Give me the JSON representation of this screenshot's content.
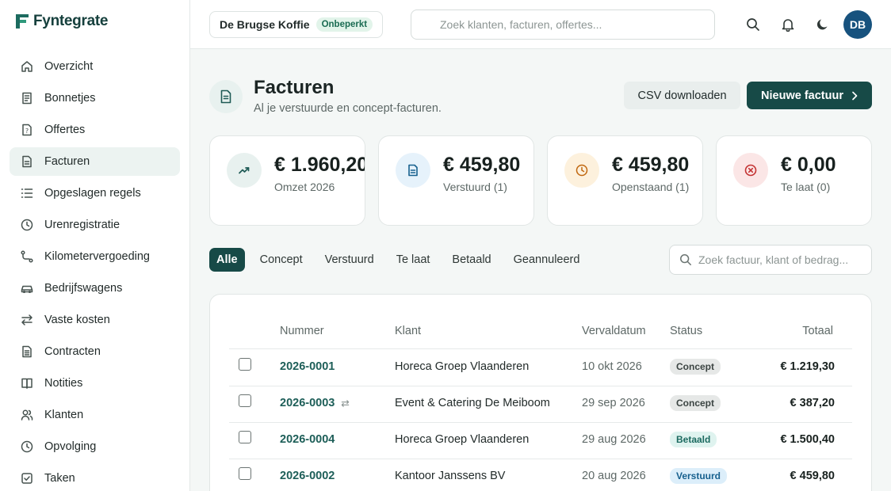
{
  "brand": {
    "name": "Fyntegrate"
  },
  "sidebar": {
    "items": [
      {
        "label": "Overzicht",
        "icon": "home-icon"
      },
      {
        "label": "Bonnetjes",
        "icon": "receipt-icon"
      },
      {
        "label": "Offertes",
        "icon": "quote-icon"
      },
      {
        "label": "Facturen",
        "icon": "invoice-icon",
        "active": true
      },
      {
        "label": "Opgeslagen regels",
        "icon": "list-icon"
      },
      {
        "label": "Urenregistratie",
        "icon": "clock-icon"
      },
      {
        "label": "Kilometervergoeding",
        "icon": "route-icon"
      },
      {
        "label": "Bedrijfswagens",
        "icon": "car-icon"
      },
      {
        "label": "Vaste kosten",
        "icon": "swap-icon"
      },
      {
        "label": "Contracten",
        "icon": "contract-icon"
      },
      {
        "label": "Notities",
        "icon": "book-icon"
      },
      {
        "label": "Klanten",
        "icon": "users-icon"
      },
      {
        "label": "Opvolging",
        "icon": "clock-icon"
      },
      {
        "label": "Taken",
        "icon": "checkbox-icon"
      }
    ]
  },
  "topbar": {
    "org_name": "De Brugse Koffie",
    "org_badge": "Onbeperkt",
    "search_placeholder": "Zoek klanten, facturen, offertes...",
    "avatar_initials": "DB"
  },
  "page": {
    "title": "Facturen",
    "subtitle": "Al je verstuurde en concept-facturen.",
    "csv_label": "CSV downloaden",
    "new_label": "Nieuwe factuur"
  },
  "stats": [
    {
      "value": "€ 1.960,20",
      "caption": "Omzet 2026",
      "icon": "trend-up-icon",
      "bg": "#e8f1ef",
      "color": "#1e5a55"
    },
    {
      "value": "€ 459,80",
      "caption": "Verstuurd (1)",
      "icon": "document-icon",
      "bg": "#e6f2fb",
      "color": "#17608e"
    },
    {
      "value": "€ 459,80",
      "caption": "Openstaand (1)",
      "icon": "clock-icon",
      "bg": "#fdf1dd",
      "color": "#c0670f"
    },
    {
      "value": "€ 0,00",
      "caption": "Te laat (0)",
      "icon": "x-circle-icon",
      "bg": "#fbe6e6",
      "color": "#c43333"
    }
  ],
  "filters": {
    "tabs": [
      "Alle",
      "Concept",
      "Verstuurd",
      "Te laat",
      "Betaald",
      "Geannuleerd"
    ],
    "active": "Alle",
    "search_placeholder": "Zoek factuur, klant of bedrag..."
  },
  "table": {
    "headers": {
      "nummer": "Nummer",
      "klant": "Klant",
      "vervaldatum": "Vervaldatum",
      "status": "Status",
      "totaal": "Totaal"
    },
    "rows": [
      {
        "nummer": "2026-0001",
        "klant": "Horeca Groep Vlaanderen",
        "vervaldatum": "10 okt 2026",
        "status": "Concept",
        "status_kind": "concept",
        "totaal": "€ 1.219,30",
        "recurring": false
      },
      {
        "nummer": "2026-0003",
        "klant": "Event & Catering De Meiboom",
        "vervaldatum": "29 sep 2026",
        "status": "Concept",
        "status_kind": "concept",
        "totaal": "€ 387,20",
        "recurring": true
      },
      {
        "nummer": "2026-0004",
        "klant": "Horeca Groep Vlaanderen",
        "vervaldatum": "29 aug 2026",
        "status": "Betaald",
        "status_kind": "betaald",
        "totaal": "€ 1.500,40",
        "recurring": false
      },
      {
        "nummer": "2026-0002",
        "klant": "Kantoor Janssens BV",
        "vervaldatum": "20 aug 2026",
        "status": "Verstuurd",
        "status_kind": "verstuurd",
        "totaal": "€ 459,80",
        "recurring": false
      }
    ]
  }
}
